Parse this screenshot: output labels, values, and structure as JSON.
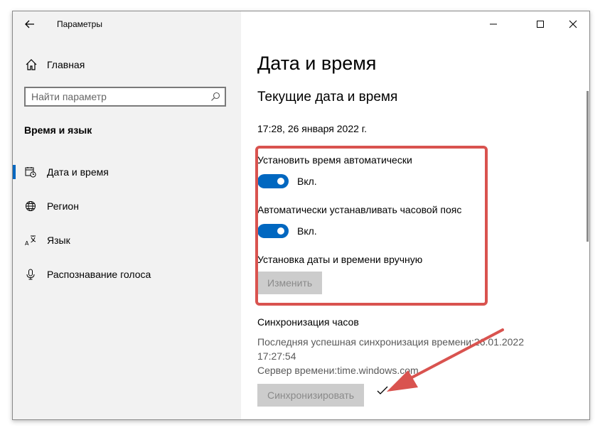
{
  "window": {
    "title": "Параметры"
  },
  "sidebar": {
    "home_label": "Главная",
    "search_placeholder": "Найти параметр",
    "section_title": "Время и язык",
    "items": [
      {
        "label": "Дата и время",
        "icon": "calendar-clock-icon",
        "active": true
      },
      {
        "label": "Регион",
        "icon": "globe-icon",
        "active": false
      },
      {
        "label": "Язык",
        "icon": "language-icon",
        "active": false
      },
      {
        "label": "Распознавание голоса",
        "icon": "microphone-icon",
        "active": false
      }
    ]
  },
  "main": {
    "page_title": "Дата и время",
    "current_section_title": "Текущие дата и время",
    "current_datetime": "17:28, 26 января 2022 г.",
    "auto_time": {
      "label": "Установить время автоматически",
      "state": "Вкл.",
      "on": true
    },
    "auto_timezone": {
      "label": "Автоматически устанавливать часовой пояс",
      "state": "Вкл.",
      "on": true
    },
    "manual": {
      "label": "Установка даты и времени вручную",
      "button": "Изменить"
    },
    "sync": {
      "title": "Синхронизация часов",
      "last_sync_line1": "Последняя успешная синхронизация времени:26.01.2022",
      "last_sync_line2": "17:27:54",
      "server": "Сервер времени:time.windows.com",
      "button": "Синхронизировать"
    }
  },
  "colors": {
    "accent": "#0067c0",
    "sidebar_bg": "#f2f2f2",
    "annotation_red": "#d9534f",
    "disabled_button_bg": "#cccccc"
  }
}
